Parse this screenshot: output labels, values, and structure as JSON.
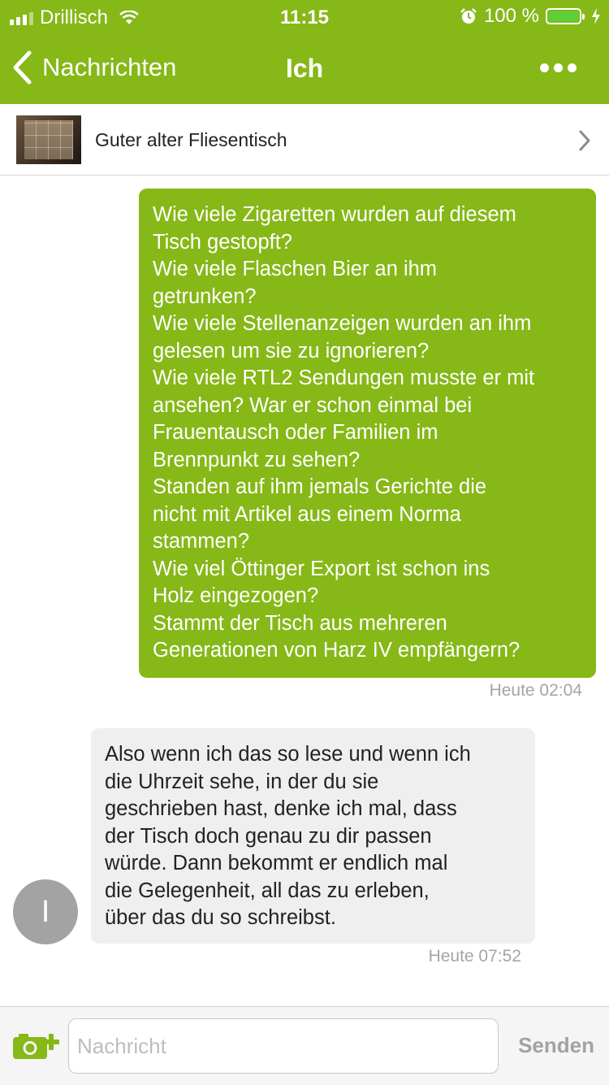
{
  "status_bar": {
    "carrier": "Drillisch",
    "time": "11:15",
    "battery_percent": "100 %",
    "icons": [
      "signal-icon",
      "wifi-icon",
      "alarm-icon",
      "battery-icon",
      "charging-bolt-icon"
    ]
  },
  "nav": {
    "back_label": "Nachrichten",
    "title": "Ich",
    "more_icon": "more-dots-icon"
  },
  "item": {
    "title": "Guter alter Fliesentisch",
    "chevron_icon": "chevron-right-icon"
  },
  "messages": [
    {
      "from": "me",
      "lines": [
        "Wie viele Zigaretten wurden auf diesem",
        "Tisch gestopft?",
        "Wie viele Flaschen Bier an ihm",
        "getrunken?",
        "Wie viele Stellenanzeigen wurden an ihm",
        "gelesen um sie zu ignorieren?",
        "Wie viele RTL2 Sendungen musste er mit",
        "ansehen? War er schon einmal bei",
        "Frauentausch oder Familien im",
        "Brennpunkt zu sehen?",
        "Standen auf ihm jemals Gerichte die",
        "nicht mit Artikel aus einem Norma",
        "stammen?",
        "Wie viel Öttinger Export ist schon ins",
        "Holz eingezogen?",
        "Stammt der Tisch aus mehreren",
        "Generationen von Harz IV empfängern?"
      ],
      "time": "Heute 02:04"
    },
    {
      "from": "other",
      "avatar_letter": "I",
      "lines": [
        "Also wenn ich das so lese und wenn ich",
        "die Uhrzeit sehe, in der du sie",
        "geschrieben hast, denke ich mal, dass",
        "der Tisch doch genau zu dir passen",
        "würde. Dann bekommt er endlich mal",
        "die Gelegenheit, all das zu erleben,",
        "über das du so schreibst."
      ],
      "time": "Heute 07:52"
    }
  ],
  "composer": {
    "placeholder": "Nachricht",
    "value": "",
    "send_label": "Senden",
    "camera_icon": "camera-add-icon"
  },
  "colors": {
    "brand_green": "#86b817",
    "incoming_bubble": "#efefef",
    "timestamp": "#a5a5a5",
    "avatar": "#a3a3a3"
  }
}
